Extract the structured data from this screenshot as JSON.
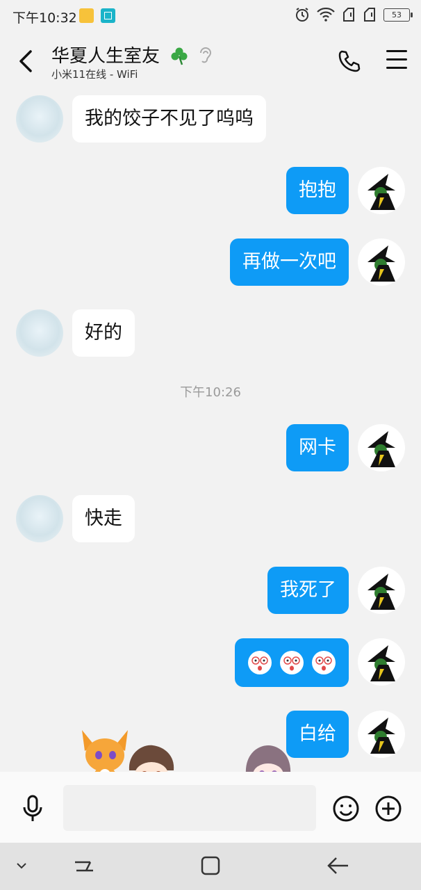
{
  "status_bar": {
    "time": "下午10:32",
    "battery": "53",
    "icons": [
      "notes-icon",
      "scan-icon",
      "alarm-icon",
      "wifi-icon",
      "signal-icon",
      "signal-icon",
      "battery-icon"
    ]
  },
  "header": {
    "title": "华夏人生室友",
    "subtitle": "小米11在线 - WiFi",
    "icons": {
      "back": "back-icon",
      "clover": "clover-icon",
      "ear": "ear-icon",
      "phone": "phone-icon",
      "menu": "menu-icon"
    }
  },
  "messages": [
    {
      "side": "in",
      "text": "我的饺子不见了呜呜"
    },
    {
      "side": "out",
      "text": "抱抱"
    },
    {
      "side": "out",
      "text": "再做一次吧"
    },
    {
      "side": "in",
      "text": "好的"
    },
    {
      "side": "out",
      "text": "网卡"
    },
    {
      "side": "in",
      "text": "快走"
    },
    {
      "side": "out",
      "text": "我死了"
    },
    {
      "side": "out",
      "text": "",
      "emoji_count": 3
    },
    {
      "side": "out",
      "text": "白给"
    }
  ],
  "timestamp": "下午10:26",
  "input": {
    "value": "",
    "placeholder": ""
  },
  "colors": {
    "accent": "#0e9bf6",
    "background": "#f2f2f2",
    "bubble_in": "#ffffff"
  }
}
